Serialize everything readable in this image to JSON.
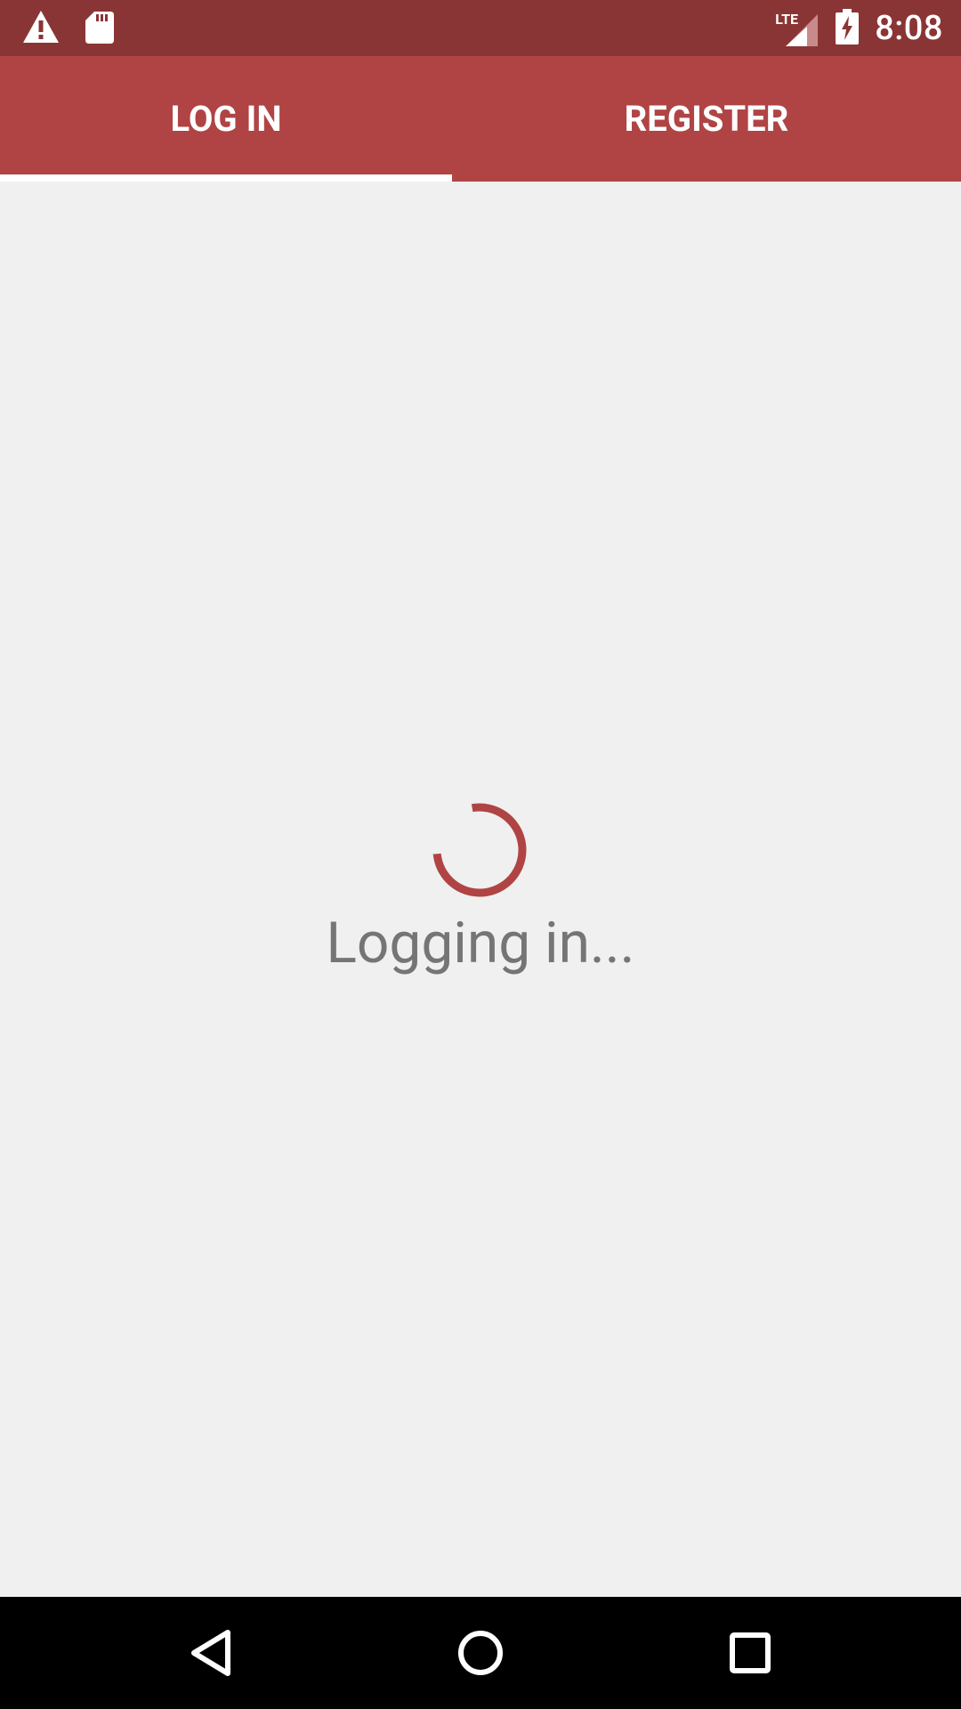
{
  "status_bar": {
    "left_icons": [
      "warning-icon",
      "sd-card-icon"
    ],
    "network_label": "LTE",
    "time": "8:08"
  },
  "tabs": [
    {
      "label": "LOG IN",
      "selected": true
    },
    {
      "label": "REGISTER",
      "selected": false
    }
  ],
  "loading": {
    "message": "Logging in..."
  },
  "nav_bar": {
    "buttons": [
      "back-icon",
      "home-icon",
      "recents-icon"
    ]
  },
  "colors": {
    "status_bar": "#8a3535",
    "accent": "#b04444",
    "background": "#f0f0f0",
    "text_secondary": "#757575"
  }
}
